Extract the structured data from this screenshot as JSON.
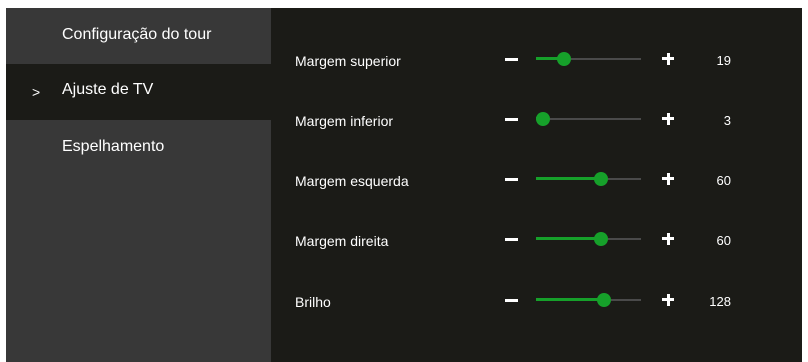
{
  "sidebar": {
    "items": [
      {
        "label": "Configuração do tour",
        "selected": false
      },
      {
        "label": "Ajuste de TV",
        "selected": true
      },
      {
        "label": "Espelhamento",
        "selected": false
      }
    ],
    "selected_marker": ">"
  },
  "settings": {
    "accent_color": "#16a02a",
    "rows": [
      {
        "label": "Margem superior",
        "value": "19",
        "level": 0.27
      },
      {
        "label": "Margem inferior",
        "value": "3",
        "level": 0.07
      },
      {
        "label": "Margem esquerda",
        "value": "60",
        "level": 0.62
      },
      {
        "label": "Margem direita",
        "value": "60",
        "level": 0.62
      },
      {
        "label": "Brilho",
        "value": "128",
        "level": 0.65
      }
    ],
    "decrease_icon": "minus-icon",
    "increase_icon": "plus-icon"
  }
}
